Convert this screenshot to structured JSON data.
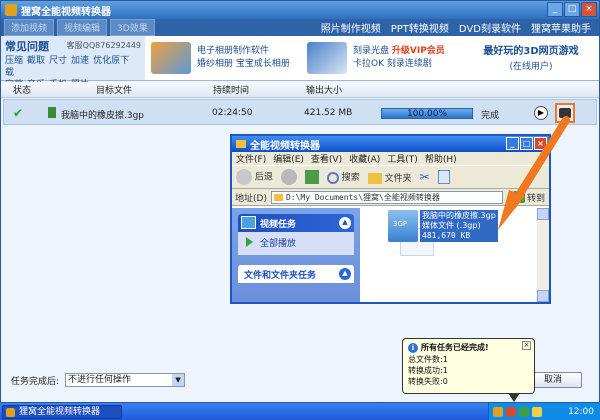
{
  "app": {
    "title": "狸窝全能视频转换器"
  },
  "window_buttons": [
    "_",
    "□",
    "×"
  ],
  "toolbar": {
    "add_video": "添加视频",
    "video_edit": "视频编辑",
    "3d_effect": "3D效果"
  },
  "top_links": [
    "照片制作视频",
    "PPT转换视频",
    "DVD刻录软件",
    "狸窝苹果助手"
  ],
  "faq": {
    "title": "常见问题",
    "qq": "客服QQ876292449",
    "links_row1": [
      "压缩",
      "截取",
      "尺寸",
      "加速",
      "优化原下载"
    ],
    "links_row2": [
      "字幕",
      "音乐",
      "手机",
      "照片"
    ]
  },
  "promos": [
    {
      "line1": "电子相册制作软件",
      "line2": "婚纱相册  宝宝成长相册"
    },
    {
      "line1a": "刻录光盘",
      "line1b": "升级VIP会员",
      "line2": "卡拉OK  刻录连续剧"
    },
    {
      "line1": "最好玩的3D网页游戏",
      "line2": "(在线用户)"
    }
  ],
  "table": {
    "headers": [
      "状态",
      "目标文件",
      "持续时间",
      "输出大小"
    ],
    "rows": [
      {
        "file": "我脑中的橡皮擦.3gp",
        "duration": "02:24:50",
        "size": "421.52 MB",
        "progress": 1.0,
        "progress_label": "100.00%",
        "status": "完成"
      }
    ]
  },
  "explorer": {
    "title": "全能视频转换器",
    "menu": [
      "文件(F)",
      "编辑(E)",
      "查看(V)",
      "收藏(A)",
      "工具(T)",
      "帮助(H)"
    ],
    "toolbar": {
      "back": "后退",
      "search": "搜索",
      "folders": "文件夹"
    },
    "address_label": "地址(D)",
    "address": "D:\\My Documents\\狸窝\\全能视频转换器",
    "go": "转到",
    "tasks": {
      "video_tasks": "视频任务",
      "play_all": "全部播放",
      "file_folder_tasks": "文件和文件夹任务"
    },
    "file": {
      "name": "我脑中的橡皮擦.3gp",
      "type": "媒体文件 (.3gp)",
      "size": "481,670 KB"
    }
  },
  "footer": {
    "after_label": "任务完成后:",
    "after_value": "不进行任何操作",
    "cancel": "取消"
  },
  "balloon": {
    "title": "所有任务已经完成!",
    "total": "总文件数:1",
    "success": "转换成功:1",
    "fail": "转换失败:0"
  },
  "taskbar": {
    "task": "狸窝全能视频转换器",
    "clock": "12:00"
  },
  "colors": {
    "accent": "#2f63a8",
    "highlight": "#f07820",
    "title_gradient_top": "#5fa0e0"
  }
}
